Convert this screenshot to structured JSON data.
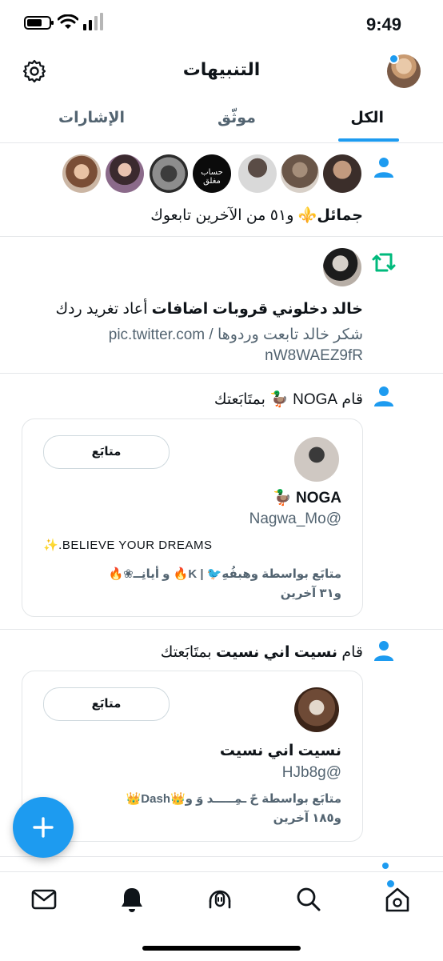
{
  "status_bar": {
    "time": "9:49"
  },
  "header": {
    "title": "التنبيهات"
  },
  "tabs": [
    {
      "label": "الكل",
      "active": true
    },
    {
      "label": "موثّق",
      "active": false
    },
    {
      "label": "الإشارات",
      "active": false
    }
  ],
  "notifications": {
    "followers_group": {
      "bold_name": "جمائل⚜️",
      "text": " و٥١ من الآخرين تابعوك",
      "avatar_locked_label": "حساب مغلق"
    },
    "retweet": {
      "bold_name": "خالد دخلوني قروبات اضافات",
      "text": " أعاد تغريد ردك",
      "quote_line1": "شكر خالد تابعت وردوها / pic.twitter.com",
      "quote_line2": "nW8WAEZ9fR"
    },
    "follow_1": {
      "prefix": "قام",
      "name": "NOGA 🦆",
      "suffix": "بمتَابَعتك",
      "card": {
        "follow_label": "متابَع",
        "display_name": "NOGA 🦆",
        "handle": "@Nagwa_Mo",
        "bio": "✨.BELIEVE YOUR DREAMS",
        "followed_by": "متابَع بواسطة وهبفُهِ🐦 | K🔥 و أيانِــ❀🔥",
        "others": "و٣١ آخرين"
      }
    },
    "follow_2": {
      "prefix": "قام",
      "name": "نسيت اني نسيت",
      "suffix": "بمتَابَعتك",
      "card": {
        "follow_label": "متابَع",
        "display_name": "نسيت اني نسيت",
        "handle": "@HJb8g",
        "followed_by": "متابَع بواسطة حً ـمِـــــد وَ و👑Dash👑",
        "others": "و١٨٥ آخرين"
      }
    }
  },
  "colors": {
    "accent": "#1d9bf0",
    "retweet_green": "#00ba7c",
    "secondary_text": "#536471"
  },
  "icons": {
    "settings": "gear-icon",
    "person": "person-icon",
    "retweet": "retweet-icon",
    "compose": "plus-icon",
    "nav": [
      "mail-icon",
      "bell-icon",
      "spaces-icon",
      "search-icon",
      "home-icon"
    ]
  }
}
